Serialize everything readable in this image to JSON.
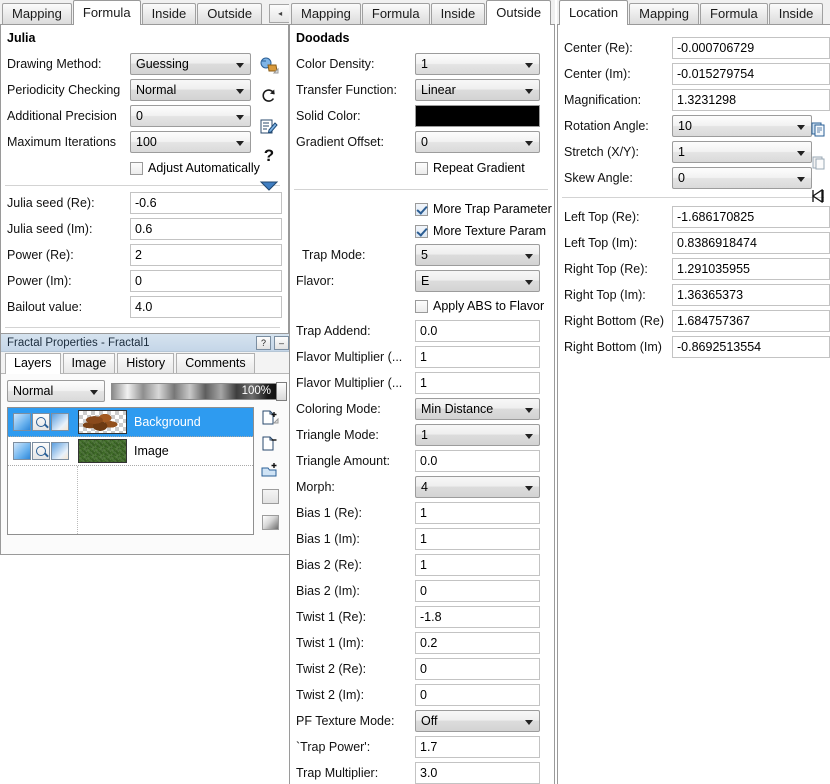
{
  "left_panel": {
    "tabs": [
      {
        "label": "Mapping",
        "active": false
      },
      {
        "label": "Formula",
        "active": true
      },
      {
        "label": "Inside",
        "active": false
      },
      {
        "label": "Outside",
        "active": false
      }
    ],
    "nav_prev": "◂",
    "nav_next": "▸",
    "section_title": "Julia",
    "icons": [
      "browse-formula-icon",
      "reload-icon",
      "edit-formula-icon",
      "help-icon",
      "expand-icon"
    ],
    "rows": [
      {
        "label": "Drawing Method:",
        "value": "Guessing",
        "type": "combo"
      },
      {
        "label": "Periodicity Checking",
        "value": "Normal",
        "type": "combo"
      },
      {
        "label": "Additional Precision",
        "value": "0",
        "type": "combo"
      },
      {
        "label": "Maximum Iterations",
        "value": "100",
        "type": "combo"
      }
    ],
    "checkbox": {
      "label": "Adjust Automatically",
      "checked": false
    },
    "fields": [
      {
        "label": "Julia seed (Re):",
        "value": "-0.6"
      },
      {
        "label": "Julia seed (Im):",
        "value": "0.6"
      },
      {
        "label": "Power (Re):",
        "value": "2"
      },
      {
        "label": "Power (Im):",
        "value": "0"
      },
      {
        "label": "Bailout value:",
        "value": "4.0"
      }
    ]
  },
  "fractal_props": {
    "title": "Fractal Properties - Fractal1",
    "help_btn": "?",
    "minimize_btn": "–",
    "tabs": [
      {
        "label": "Layers",
        "active": true
      },
      {
        "label": "Image",
        "active": false
      },
      {
        "label": "History",
        "active": false
      },
      {
        "label": "Comments",
        "active": false
      }
    ],
    "blend_mode": "Normal",
    "opacity": "100%",
    "layers": [
      {
        "name": "Background",
        "selected": true,
        "thumb": "leaf"
      },
      {
        "name": "Image",
        "selected": false,
        "thumb": "green"
      }
    ],
    "side_buttons": [
      "add-layer-icon",
      "delete-layer-icon",
      "add-group-icon",
      "merge-layer-icon",
      "gradient-layer-icon"
    ]
  },
  "mid_panel": {
    "tabs": [
      {
        "label": "Mapping",
        "active": false
      },
      {
        "label": "Formula",
        "active": false
      },
      {
        "label": "Inside",
        "active": false
      },
      {
        "label": "Outside",
        "active": true
      }
    ],
    "nav_prev": "◂",
    "section_title": "Doodads",
    "rows": [
      {
        "label": "Color Density:",
        "value": "1",
        "type": "combo"
      },
      {
        "label": "Transfer Function:",
        "value": "Linear",
        "type": "combo"
      },
      {
        "label": "Solid Color:",
        "value": "#000000",
        "type": "color"
      },
      {
        "label": "Gradient Offset:",
        "value": "0",
        "type": "combo"
      }
    ],
    "repeat_gradient": {
      "label": "Repeat Gradient",
      "checked": false
    },
    "more_trap": {
      "label": "More Trap Parameter",
      "checked": true
    },
    "more_texture": {
      "label": "More Texture Param",
      "checked": true
    },
    "trap_mode": {
      "label": "Trap Mode:",
      "value": "5"
    },
    "flavor": {
      "label": "Flavor:",
      "value": "E"
    },
    "apply_abs": {
      "label": "Apply ABS to Flavor",
      "checked": false
    },
    "fields": [
      {
        "label": "Trap Addend:",
        "value": "0.0",
        "type": "text"
      },
      {
        "label": "Flavor Multiplier (...",
        "value": "1",
        "type": "text"
      },
      {
        "label": "Flavor Multiplier (...",
        "value": "1",
        "type": "text"
      },
      {
        "label": "Coloring Mode:",
        "value": "Min Distance",
        "type": "combo"
      },
      {
        "label": "Triangle Mode:",
        "value": "1",
        "type": "combo"
      },
      {
        "label": "Triangle Amount:",
        "value": "0.0",
        "type": "text"
      },
      {
        "label": "Morph:",
        "value": "4",
        "type": "combo"
      },
      {
        "label": "Bias 1 (Re):",
        "value": "1",
        "type": "text"
      },
      {
        "label": "Bias 1 (Im):",
        "value": "1",
        "type": "text"
      },
      {
        "label": "Bias 2 (Re):",
        "value": "1",
        "type": "text"
      },
      {
        "label": "Bias 2 (Im):",
        "value": "0",
        "type": "text"
      },
      {
        "label": "Twist 1 (Re):",
        "value": "-1.8",
        "type": "text"
      },
      {
        "label": "Twist 1 (Im):",
        "value": "0.2",
        "type": "text"
      },
      {
        "label": "Twist 2 (Re):",
        "value": "0",
        "type": "text"
      },
      {
        "label": "Twist 2 (Im):",
        "value": "0",
        "type": "text"
      },
      {
        "label": "PF Texture Mode:",
        "value": "Off",
        "type": "combo"
      },
      {
        "label": "`Trap Power':",
        "value": "1.7",
        "type": "text"
      },
      {
        "label": "Trap Multiplier:",
        "value": "3.0",
        "type": "text"
      }
    ]
  },
  "right_panel": {
    "tabs": [
      {
        "label": "Location",
        "active": true
      },
      {
        "label": "Mapping",
        "active": false
      },
      {
        "label": "Formula",
        "active": false
      },
      {
        "label": "Inside",
        "active": false
      }
    ],
    "nav_prev": "◂",
    "rows": [
      {
        "label": "Center (Re):",
        "value": "-0.000706729",
        "type": "text"
      },
      {
        "label": "Center (Im):",
        "value": "-0.015279754",
        "type": "text"
      },
      {
        "label": "Magnification:",
        "value": "1.3231298",
        "type": "text"
      },
      {
        "label": "Rotation Angle:",
        "value": "10",
        "type": "combo"
      },
      {
        "label": "Stretch (X/Y):",
        "value": "1",
        "type": "combo"
      },
      {
        "label": "Skew Angle:",
        "value": "0",
        "type": "combo"
      }
    ],
    "icons": [
      "copy-location-icon",
      "paste-location-icon",
      "goto-icon"
    ],
    "corners": [
      {
        "label": "Left Top (Re):",
        "value": "-1.686170825"
      },
      {
        "label": "Left Top (Im):",
        "value": "0.8386918474"
      },
      {
        "label": "Right Top (Re):",
        "value": "1.291035955"
      },
      {
        "label": "Right Top (Im):",
        "value": "1.36365373"
      },
      {
        "label": "Right Bottom (Re)",
        "value": "1.684757367"
      },
      {
        "label": "Right Bottom (Im)",
        "value": "-0.8692513554"
      }
    ]
  }
}
